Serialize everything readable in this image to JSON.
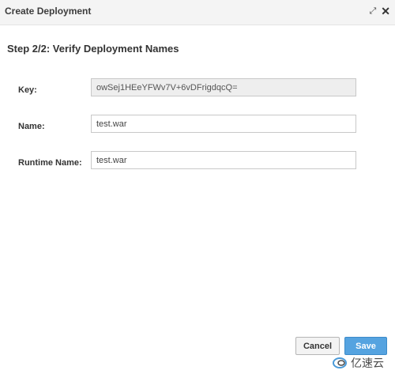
{
  "window": {
    "title": "Create Deployment",
    "controls": {
      "maximize_glyph": "⤢",
      "close_glyph": "✕"
    }
  },
  "step": {
    "title": "Step 2/2: Verify Deployment Names"
  },
  "fields": {
    "key": {
      "label": "Key:",
      "value": "owSej1HEeYFWv7V+6vDFrigdqcQ="
    },
    "name": {
      "label": "Name:",
      "value": "test.war"
    },
    "runtime_name": {
      "label": "Runtime Name:",
      "value": "test.war"
    }
  },
  "buttons": {
    "cancel": "Cancel",
    "save": "Save"
  },
  "watermark": {
    "text": "亿速云"
  },
  "colors": {
    "primary_button": "#55a3e0",
    "titlebar": "#f4f4f4",
    "readonly_field": "#eeeeee"
  }
}
